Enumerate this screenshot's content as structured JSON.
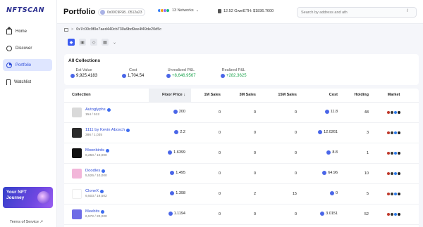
{
  "app": {
    "logo": "NFTSCAN"
  },
  "sidebar": {
    "items": [
      {
        "label": "Home",
        "icon": "home-icon",
        "active": false
      },
      {
        "label": "Discover",
        "icon": "compass-icon",
        "active": false
      },
      {
        "label": "Portfolio",
        "icon": "portfolio-icon",
        "active": true
      },
      {
        "label": "Watchlist",
        "icon": "bookmark-icon",
        "active": false
      }
    ],
    "promo": "Your NFT Journey",
    "terms": "Terms of Service ↗"
  },
  "header": {
    "title": "Portfolio",
    "wallet": "0x00C9F98...0512a23",
    "networks": "13 Networks",
    "gas": "12.52 Gwei",
    "eth_price": "ETH: $1836.7600",
    "search_placeholder": "Search by address and ath",
    "search_hint": "/"
  },
  "address": "0x7c00c9f0e7aed440cb730a9bd9ee4f49de20d5c",
  "summary": {
    "title": "All Collections",
    "est_value_label": "Est Value",
    "est_value": "9,925.4183",
    "cost_label": "Cost",
    "cost": "1,704.54",
    "unrealized_label": "Unrealized P&L",
    "unrealized": "+8,646.9567",
    "realized_label": "Realized P&L",
    "realized": "+282.3625"
  },
  "table": {
    "headers": {
      "collection": "Collection",
      "floor": "Floor Price ↓",
      "sales1m": "1M Sales",
      "sales3m": "3M Sales",
      "sales15m": "15M Sales",
      "cost": "Cost",
      "holding": "Holding",
      "market": "Market"
    },
    "rows": [
      {
        "name": "Autoglyphs",
        "sub": "154 / 512",
        "floor": "200",
        "s1": "0",
        "s3": "0",
        "s15": "0",
        "cost": "11.8",
        "holding": "48",
        "thumb": "#d9d9d9"
      },
      {
        "name": "1111 by Kevin Abosch",
        "sub": "386 / 1,035",
        "floor": "2.2",
        "s1": "0",
        "s3": "0",
        "s15": "0",
        "cost": "12.0261",
        "holding": "3",
        "thumb": "#2b2b2b"
      },
      {
        "name": "Moonbirds",
        "sub": "6,250 / 10,000",
        "floor": "1.6399",
        "s1": "0",
        "s3": "0",
        "s15": "0",
        "cost": "8.8",
        "holding": "1",
        "thumb": "#111111"
      },
      {
        "name": "Doodles",
        "sub": "5,526 / 10,000",
        "floor": "1.495",
        "s1": "0",
        "s3": "0",
        "s15": "0",
        "cost": "64.96",
        "holding": "10",
        "thumb": "#f2b6d9"
      },
      {
        "name": "CloneX",
        "sub": "9,503 / 19,502",
        "floor": "1.398",
        "s1": "0",
        "s3": "2",
        "s15": "15",
        "cost": "0",
        "holding": "5",
        "thumb": "#ffffff"
      },
      {
        "name": "Meebits",
        "sub": "6,572 / 20,000",
        "floor": "1.1194",
        "s1": "0",
        "s3": "0",
        "s15": "0",
        "cost": "3.0151",
        "holding": "52",
        "thumb": "#6f6ce6"
      }
    ]
  }
}
